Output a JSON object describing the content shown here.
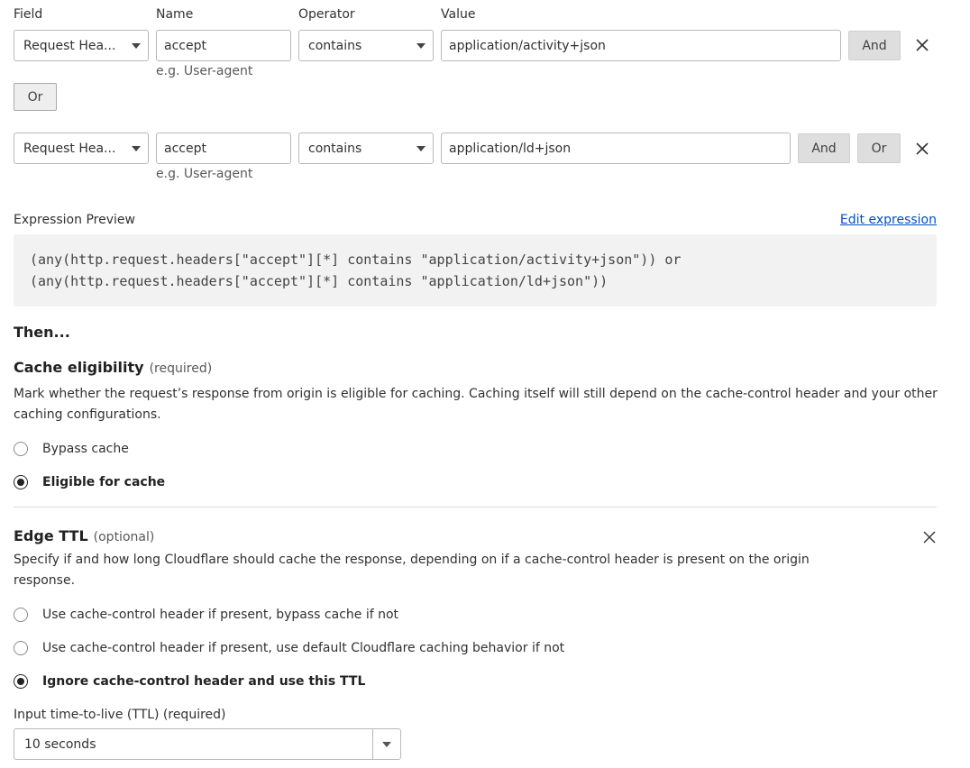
{
  "headers": {
    "field": "Field",
    "name": "Name",
    "operator": "Operator",
    "value": "Value"
  },
  "rows": [
    {
      "field": "Request Hea...",
      "name": "accept",
      "name_hint": "e.g. User-agent",
      "operator": "contains",
      "value": "application/activity+json",
      "and_label": "And"
    },
    {
      "field": "Request Hea...",
      "name": "accept",
      "name_hint": "e.g. User-agent",
      "operator": "contains",
      "value": "application/ld+json",
      "and_label": "And",
      "or_label": "Or"
    }
  ],
  "or_group_label": "Or",
  "expression": {
    "label": "Expression Preview",
    "edit_link": "Edit expression",
    "line1": "(any(http.request.headers[\"accept\"][*] contains \"application/activity+json\")) or",
    "line2": "(any(http.request.headers[\"accept\"][*] contains \"application/ld+json\"))"
  },
  "then_label": "Then...",
  "cache_eligibility": {
    "title": "Cache eligibility",
    "note": "(required)",
    "line1": "Mark whether the request’s response from origin is eligible for caching. Caching itself will still depend on the cache-control header and your other",
    "line2": "caching configurations.",
    "options": [
      "Bypass cache",
      "Eligible for cache"
    ],
    "selected_index": 1
  },
  "edge_ttl": {
    "title": "Edge TTL",
    "note": "(optional)",
    "line1": "Specify if and how long Cloudflare should cache the response, depending on if a cache-control header is present on the origin",
    "line2": "response.",
    "options": [
      "Use cache-control header if present, bypass cache if not",
      "Use cache-control header if present, use default Cloudflare caching behavior if not",
      "Ignore cache-control header and use this TTL"
    ],
    "selected_index": 2,
    "ttl_label": "Input time-to-live (TTL) (required)",
    "ttl_value": "10 seconds"
  }
}
